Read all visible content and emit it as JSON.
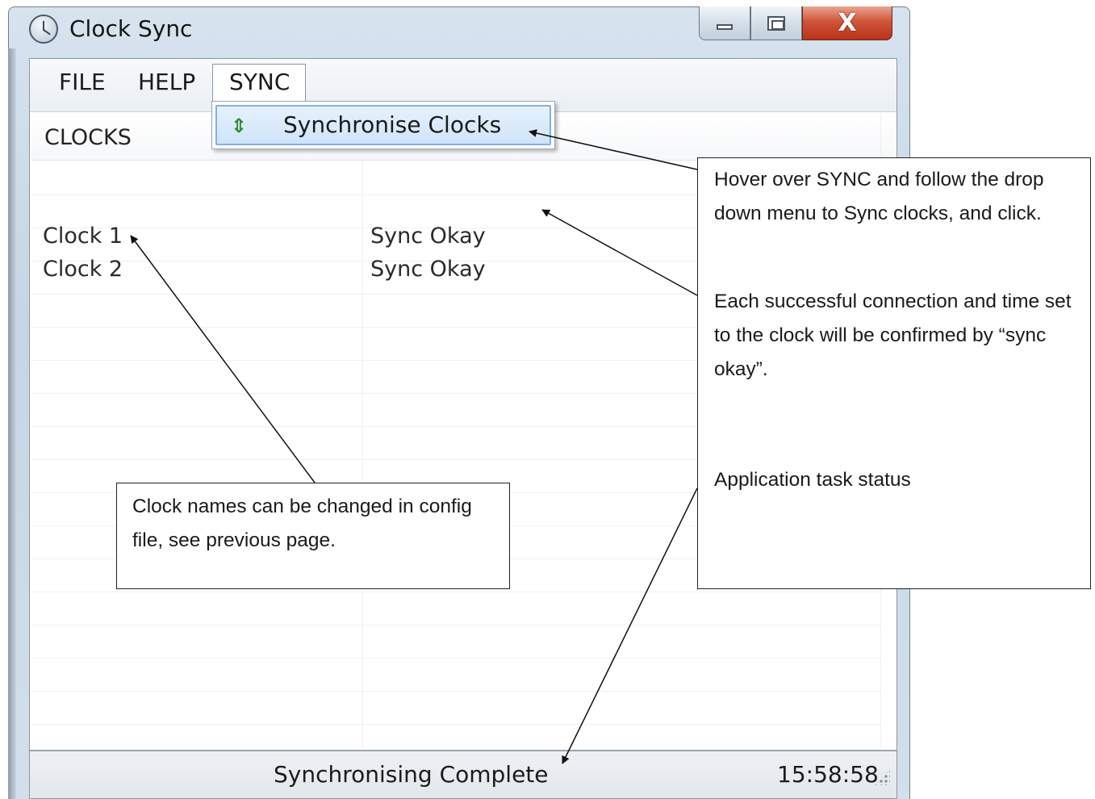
{
  "window": {
    "title": "Clock Sync",
    "icon": "clock-icon",
    "controls": [
      "minimize-icon",
      "maximize-icon",
      "close-icon"
    ],
    "close_glyph": "X"
  },
  "menubar": {
    "file": "FILE",
    "help": "HELP",
    "sync": "SYNC"
  },
  "dropdown": {
    "item_icon": "sync-arrows-icon",
    "item_label": "Synchronise Clocks"
  },
  "listview": {
    "header": "CLOCKS",
    "rows": [
      {
        "name": "Clock 1",
        "status": "Sync Okay"
      },
      {
        "name": "Clock 2",
        "status": "Sync Okay"
      }
    ]
  },
  "statusbar": {
    "text": "Synchronising Complete",
    "time": "15:58:58"
  },
  "annotations": {
    "right": {
      "p1": "Hover over SYNC and follow the drop down menu to Sync clocks, and click.",
      "p2": "Each successful connection and time set to the clock will be confirmed by “sync okay”.",
      "p3": "Application task status"
    },
    "left": {
      "p1": "Clock names can be changed in config file, see previous page."
    }
  },
  "colors": {
    "close_button": "#c8432a",
    "highlight": "#cfe4fa",
    "highlight_border": "#7fb1e6",
    "sync_icon": "#2e8b2e"
  }
}
